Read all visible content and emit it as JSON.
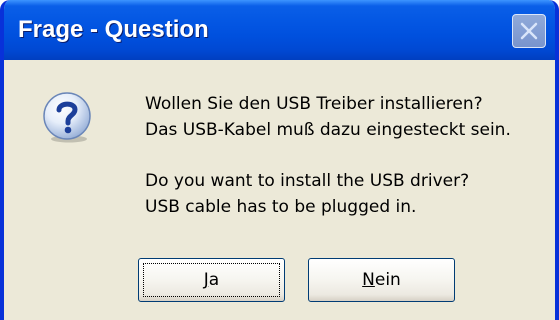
{
  "window": {
    "title": "Frage - Question",
    "close_icon": "close-icon"
  },
  "message": {
    "icon": "question-icon",
    "lines_de": [
      "Wollen Sie den USB Treiber installieren?",
      "Das USB-Kabel muß dazu eingesteckt sein."
    ],
    "lines_en": [
      "Do you want to install the USB driver?",
      "USB cable has to be plugged in."
    ]
  },
  "buttons": {
    "yes": {
      "mnemonic": "J",
      "rest": "a"
    },
    "no": {
      "mnemonic": "N",
      "rest": "ein"
    }
  },
  "colors": {
    "titlebar": "#0050de",
    "frame": "#0831d9",
    "dialog_bg": "#ece9d8"
  }
}
